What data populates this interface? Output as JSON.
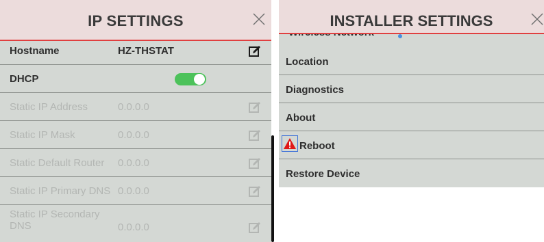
{
  "ip_settings": {
    "title": "IP SETTINGS",
    "rows": [
      {
        "label": "Hostname",
        "value": "HZ-THSTAT",
        "enabled": true
      },
      {
        "label": "DHCP",
        "toggle_on": true,
        "enabled": true
      },
      {
        "label": "Static IP Address",
        "value": "0.0.0.0",
        "enabled": false
      },
      {
        "label": "Static IP Mask",
        "value": "0.0.0.0",
        "enabled": false
      },
      {
        "label": "Static Default Router",
        "value": "0.0.0.0",
        "enabled": false
      },
      {
        "label": "Static IP Primary DNS",
        "value": "0.0.0.0",
        "enabled": false
      },
      {
        "label_line1": "Static IP Secondary",
        "label_line2": "DNS",
        "value": "0.0.0.0",
        "enabled": false
      }
    ]
  },
  "installer_settings": {
    "title": "INSTALLER SETTINGS",
    "partial_item": "Wireless Network",
    "items": [
      "Location",
      "Diagnostics",
      "About",
      "Reboot",
      "Restore Device"
    ]
  },
  "colors": {
    "panel_bg": "#d4d8d4",
    "header_bg": "#ecdcdc",
    "header_underline": "#e04040",
    "toggle_on": "#4cc25a",
    "warning": "#e01818",
    "disabled_text": "#b3b6b3"
  },
  "icons": {
    "close": "close-icon",
    "edit": "edit-icon",
    "warning": "warning-icon"
  }
}
